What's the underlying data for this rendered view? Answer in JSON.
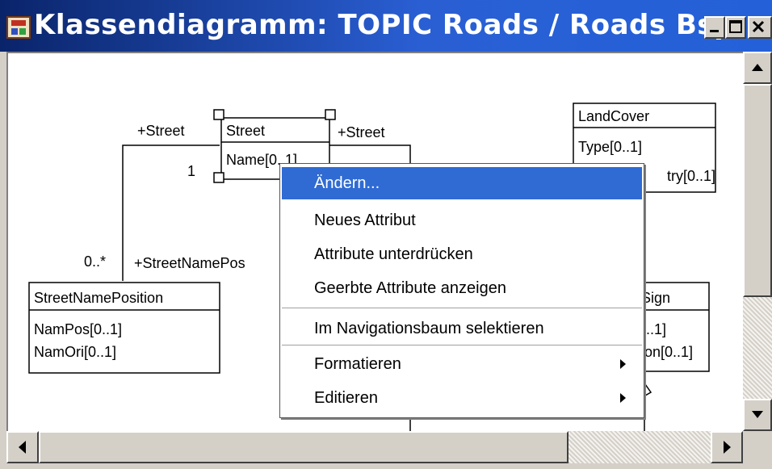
{
  "window": {
    "title": "Klassendiagramm: TOPIC Roads / Roads Bsp.",
    "icon": "app-icon",
    "controls": [
      "minimize-icon",
      "maximize-icon",
      "close-icon"
    ]
  },
  "diagram": {
    "classes": [
      {
        "id": "street",
        "name": "Street",
        "attributes": [
          "Name[0..1]"
        ]
      },
      {
        "id": "landcover",
        "name": "LandCover",
        "attributes": [
          "Type[0..1]",
          "try[0..1]"
        ]
      },
      {
        "id": "streetnameposition",
        "name": "StreetNamePosition",
        "attributes": [
          "NamPos[0..1]",
          "NamOri[0..1]"
        ]
      },
      {
        "id": "sign",
        "name": "Sign",
        "attributes": [
          "..1]",
          "on[0..1]"
        ]
      }
    ],
    "labels": {
      "role_left": "+Street",
      "role_right": "+Street",
      "mult_one": "1",
      "mult_many": "0..*",
      "role_snp": "+StreetNamePos"
    }
  },
  "context_menu": {
    "items": [
      {
        "label": "Ändern...",
        "selected": true,
        "submenu": false
      },
      {
        "label": "Neues Attribut",
        "selected": false,
        "submenu": false
      },
      {
        "label": "Attribute unterdrücken",
        "selected": false,
        "submenu": false
      },
      {
        "label": "Geerbte Attribute anzeigen",
        "selected": false,
        "submenu": false
      },
      {
        "label": "Im Navigationsbaum selektieren",
        "selected": false,
        "submenu": false
      },
      {
        "label": "Formatieren",
        "selected": false,
        "submenu": true
      },
      {
        "label": "Editieren",
        "selected": false,
        "submenu": true
      }
    ]
  },
  "colors": {
    "title_bar": "#0a246a",
    "menu_highlight": "#2f6bd3"
  }
}
